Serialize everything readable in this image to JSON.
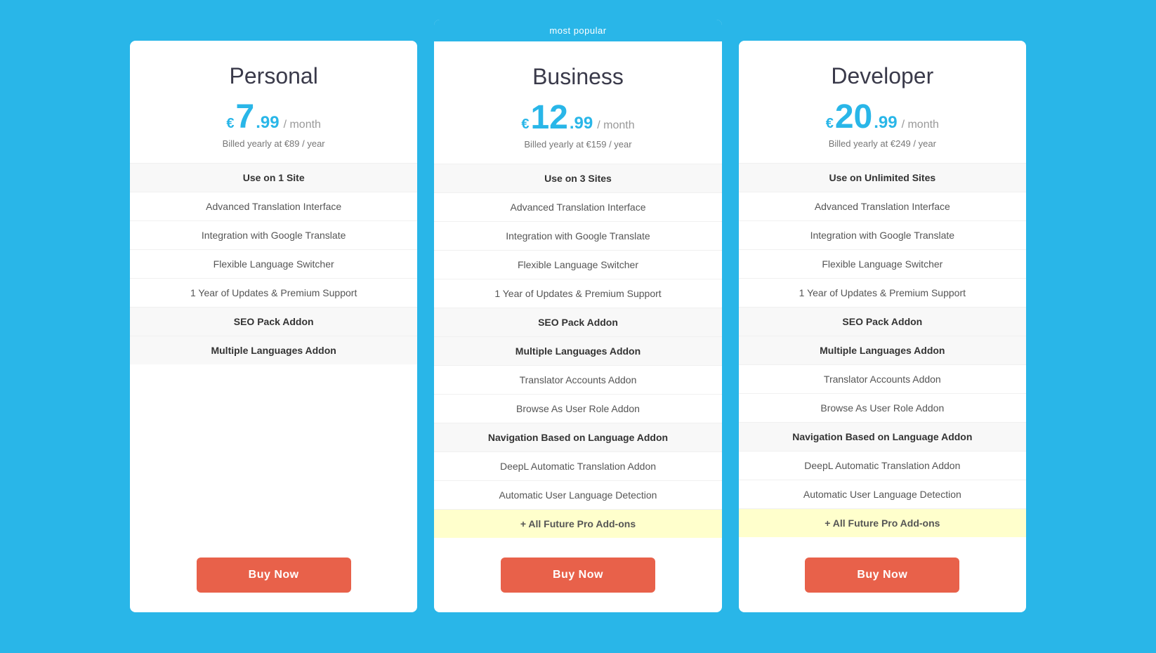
{
  "plans": [
    {
      "id": "personal",
      "name": "Personal",
      "currency": "€",
      "price": "7",
      "price_cents": "99",
      "period": "/ month",
      "billed": "Billed yearly at €89 / year",
      "featured": false,
      "banner": "",
      "features": [
        {
          "label": "Use on 1 Site",
          "highlight": true,
          "future": false
        },
        {
          "label": "Advanced Translation Interface",
          "highlight": false,
          "future": false
        },
        {
          "label": "Integration with Google Translate",
          "highlight": false,
          "future": false
        },
        {
          "label": "Flexible Language Switcher",
          "highlight": false,
          "future": false
        },
        {
          "label": "1 Year of Updates & Premium Support",
          "highlight": false,
          "future": false
        },
        {
          "label": "SEO Pack Addon",
          "highlight": true,
          "future": false
        },
        {
          "label": "Multiple Languages Addon",
          "highlight": true,
          "future": false
        }
      ],
      "button_label": "Buy Now"
    },
    {
      "id": "business",
      "name": "Business",
      "currency": "€",
      "price": "12",
      "price_cents": "99",
      "period": "/ month",
      "billed": "Billed yearly at €159 / year",
      "featured": true,
      "banner": "most popular",
      "features": [
        {
          "label": "Use on 3 Sites",
          "highlight": true,
          "future": false
        },
        {
          "label": "Advanced Translation Interface",
          "highlight": false,
          "future": false
        },
        {
          "label": "Integration with Google Translate",
          "highlight": false,
          "future": false
        },
        {
          "label": "Flexible Language Switcher",
          "highlight": false,
          "future": false
        },
        {
          "label": "1 Year of Updates & Premium Support",
          "highlight": false,
          "future": false
        },
        {
          "label": "SEO Pack Addon",
          "highlight": true,
          "future": false
        },
        {
          "label": "Multiple Languages Addon",
          "highlight": true,
          "future": false
        },
        {
          "label": "Translator Accounts Addon",
          "highlight": false,
          "future": false
        },
        {
          "label": "Browse As User Role Addon",
          "highlight": false,
          "future": false
        },
        {
          "label": "Navigation Based on Language Addon",
          "highlight": true,
          "future": false
        },
        {
          "label": "DeepL Automatic Translation Addon",
          "highlight": false,
          "future": false
        },
        {
          "label": "Automatic User Language Detection",
          "highlight": false,
          "future": false
        },
        {
          "label": "+ All Future Pro Add-ons",
          "highlight": false,
          "future": true
        }
      ],
      "button_label": "Buy Now"
    },
    {
      "id": "developer",
      "name": "Developer",
      "currency": "€",
      "price": "20",
      "price_cents": "99",
      "period": "/ month",
      "billed": "Billed yearly at €249 / year",
      "featured": false,
      "banner": "",
      "features": [
        {
          "label": "Use on Unlimited Sites",
          "highlight": true,
          "future": false
        },
        {
          "label": "Advanced Translation Interface",
          "highlight": false,
          "future": false
        },
        {
          "label": "Integration with Google Translate",
          "highlight": false,
          "future": false
        },
        {
          "label": "Flexible Language Switcher",
          "highlight": false,
          "future": false
        },
        {
          "label": "1 Year of Updates & Premium Support",
          "highlight": false,
          "future": false
        },
        {
          "label": "SEO Pack Addon",
          "highlight": true,
          "future": false
        },
        {
          "label": "Multiple Languages Addon",
          "highlight": true,
          "future": false
        },
        {
          "label": "Translator Accounts Addon",
          "highlight": false,
          "future": false
        },
        {
          "label": "Browse As User Role Addon",
          "highlight": false,
          "future": false
        },
        {
          "label": "Navigation Based on Language Addon",
          "highlight": true,
          "future": false
        },
        {
          "label": "DeepL Automatic Translation Addon",
          "highlight": false,
          "future": false
        },
        {
          "label": "Automatic User Language Detection",
          "highlight": false,
          "future": false
        },
        {
          "label": "+ All Future Pro Add-ons",
          "highlight": false,
          "future": true
        }
      ],
      "button_label": "Buy Now"
    }
  ]
}
